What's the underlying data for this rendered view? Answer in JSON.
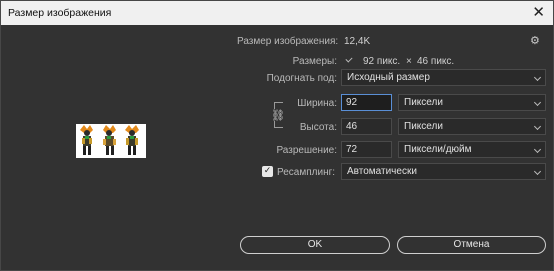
{
  "window": {
    "title": "Размер изображения",
    "close_glyph": "✕"
  },
  "image_size": {
    "label": "Размер изображения:",
    "value": "12,4K"
  },
  "settings_icon": "gear-icon",
  "dimensions": {
    "label": "Размеры:",
    "width_value": "92 пикс.",
    "times": "×",
    "height_value": "46 пикс."
  },
  "fit_to": {
    "label": "Подогнать под:",
    "selected": "Исходный размер"
  },
  "width": {
    "label": "Ширина:",
    "value": "92",
    "unit": "Пиксели"
  },
  "height": {
    "label": "Высота:",
    "value": "46",
    "unit": "Пиксели"
  },
  "resolution": {
    "label": "Разрешение:",
    "value": "72",
    "unit": "Пиксели/дюйм"
  },
  "resample": {
    "checked": true,
    "label": "Ресамплинг:",
    "selected": "Автоматически"
  },
  "buttons": {
    "ok": "OK",
    "cancel": "Отмена"
  },
  "colors": {
    "background": "#323232",
    "titlebar": "#f0f0f0",
    "focus": "#5a8fd6"
  }
}
